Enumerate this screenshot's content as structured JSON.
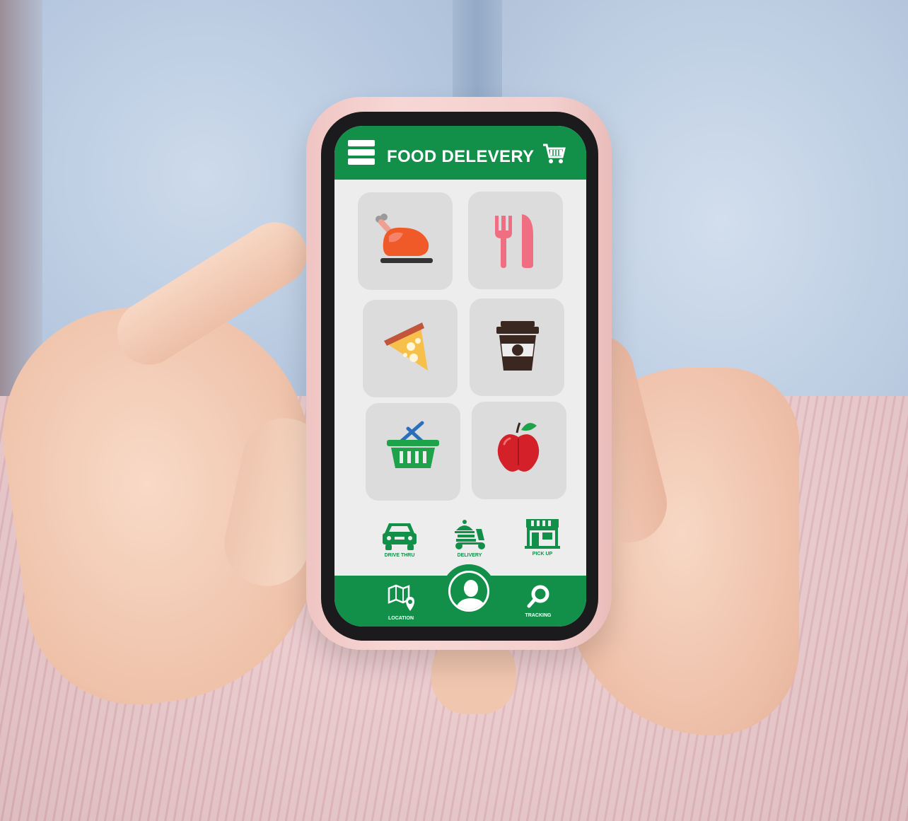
{
  "app": {
    "title": "FOOD DELEVERY"
  },
  "colors": {
    "brand_green": "#12904a",
    "screen_bg": "#ededee",
    "tile_bg": "#dcdcdd"
  },
  "categories": [
    {
      "icon": "roast-chicken-icon"
    },
    {
      "icon": "fork-knife-icon"
    },
    {
      "icon": "pizza-slice-icon"
    },
    {
      "icon": "coffee-cup-icon"
    },
    {
      "icon": "grocery-basket-icon"
    },
    {
      "icon": "apple-icon"
    }
  ],
  "services": [
    {
      "label": "DRIVE THRU",
      "icon": "car-icon"
    },
    {
      "label": "DELIVERY",
      "icon": "delivery-scooter-icon"
    },
    {
      "label": "PICK UP",
      "icon": "storefront-icon"
    }
  ],
  "bottom_nav": {
    "location_label": "LOCATION",
    "tracking_label": "TRACKING",
    "profile_icon": "user-profile-icon"
  }
}
